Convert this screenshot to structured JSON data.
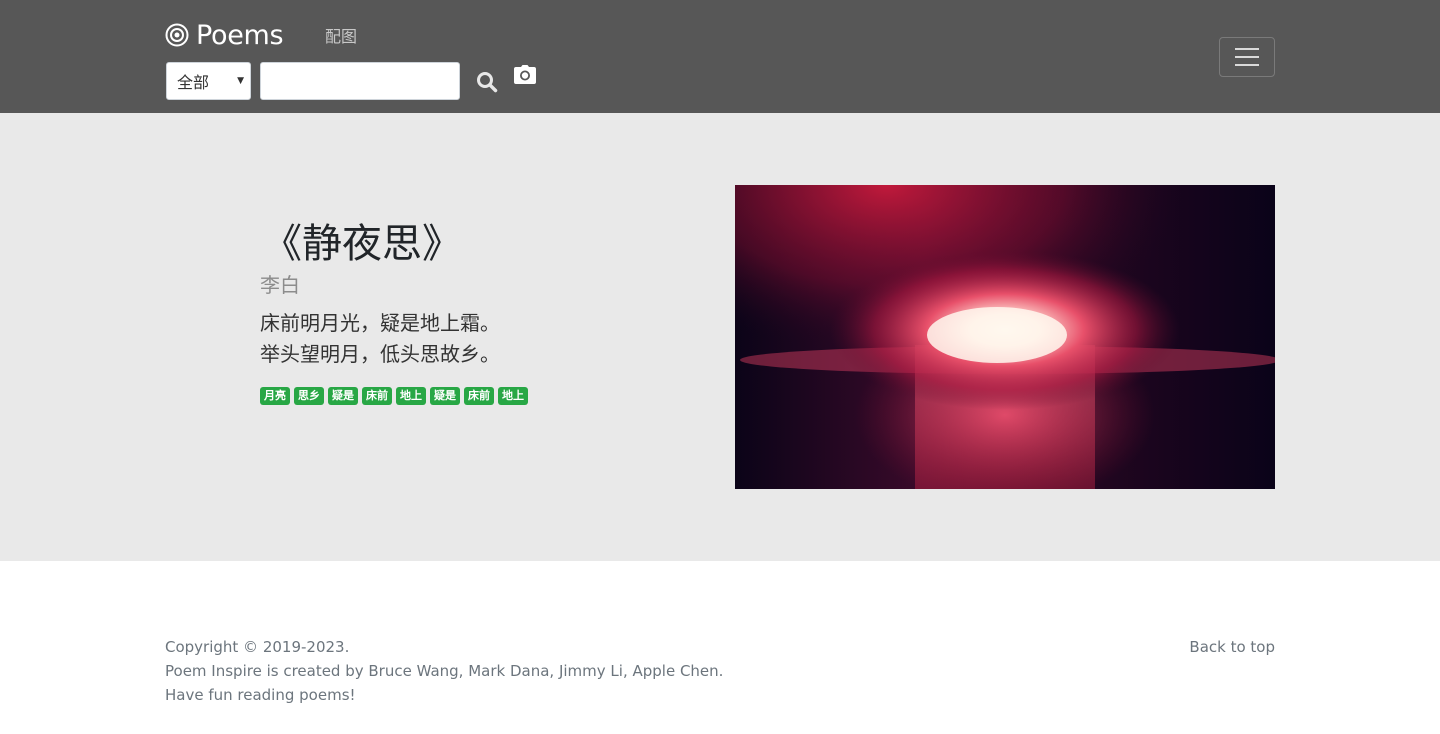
{
  "navbar": {
    "brand": "Poems",
    "brand_icon": "target-circle-icon",
    "nav_link": "配图",
    "search_category": "全部",
    "search_value": "",
    "search_icon": "search-icon",
    "camera_icon": "camera-icon",
    "menu_icon": "hamburger-menu-icon"
  },
  "poem": {
    "title": "《静夜思》",
    "author": "李白",
    "lines": [
      "床前明月光，疑是地上霜。",
      "举头望明月，低头思故乡。"
    ],
    "tags": [
      "月亮",
      "思乡",
      "疑是",
      "床前",
      "地上",
      "疑是",
      "床前",
      "地上"
    ]
  },
  "footer": {
    "lines": [
      "Copyright © 2019-2023.",
      "Poem Inspire is created by Bruce Wang, Mark Dana, Jimmy Li, Apple Chen.",
      "Have fun reading poems!"
    ],
    "back_to_top": "Back to top"
  },
  "colors": {
    "navbar_bg": "#575757",
    "hero_bg": "#e9e9e9",
    "tag_green": "#28a745",
    "footer_text": "#6c757d"
  }
}
